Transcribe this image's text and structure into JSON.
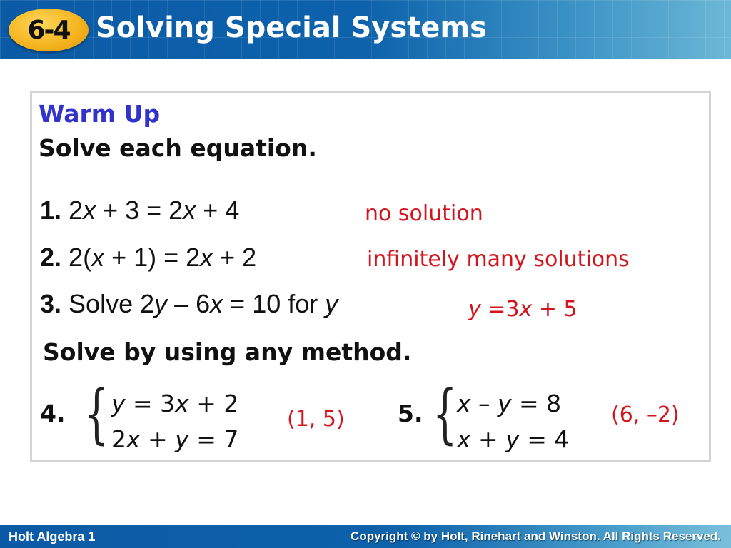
{
  "header": {
    "lesson_number": "6-4",
    "title": "Solving Special Systems"
  },
  "content": {
    "warm_up_label": "Warm Up",
    "instruction1": "Solve each equation.",
    "problems": [
      {
        "number": "1.",
        "pre": "2",
        "v1": "x",
        "mid": " + 3 = 2",
        "v2": "x",
        "post": " + 4",
        "answer": "no solution"
      },
      {
        "number": "2.",
        "pre": "2(",
        "v1": "x",
        "mid": " + 1) = 2",
        "v2": "x",
        "post": " + 2",
        "answer": "infinitely many solutions"
      },
      {
        "number": "3.",
        "pre": "Solve 2",
        "v1": "y",
        "mid": " – 6",
        "v2": "x",
        "post": " = 10 for ",
        "v3": "y",
        "answer_v1": "y",
        "answer_mid": " =3",
        "answer_v2": "x",
        "answer_post": " + 5"
      }
    ],
    "instruction2": "Solve by using any method.",
    "systems": [
      {
        "number": "4.",
        "eq1": {
          "a": "y",
          "b": " = 3",
          "c": "x",
          "d": " + 2"
        },
        "eq2": {
          "a": "2",
          "b": "x",
          "c": " + ",
          "d": "y",
          "e": " = 7"
        },
        "answer": "(1, 5)"
      },
      {
        "number": "5.",
        "eq1": {
          "a": "x",
          "b": " – ",
          "c": "y",
          "d": " = 8"
        },
        "eq2": {
          "a": "x",
          "b": " + ",
          "c": "y",
          "d": " = 4"
        },
        "answer": "(6, –2)"
      }
    ]
  },
  "footer": {
    "left": "Holt Algebra 1",
    "right": "Copyright © by Holt, Rinehart and Winston. All Rights Reserved."
  },
  "colors": {
    "header_blue": "#0b5aa5",
    "badge_yellow": "#f4b21c",
    "warm_up_blue": "#3333cc",
    "answer_red": "#d4141c"
  }
}
